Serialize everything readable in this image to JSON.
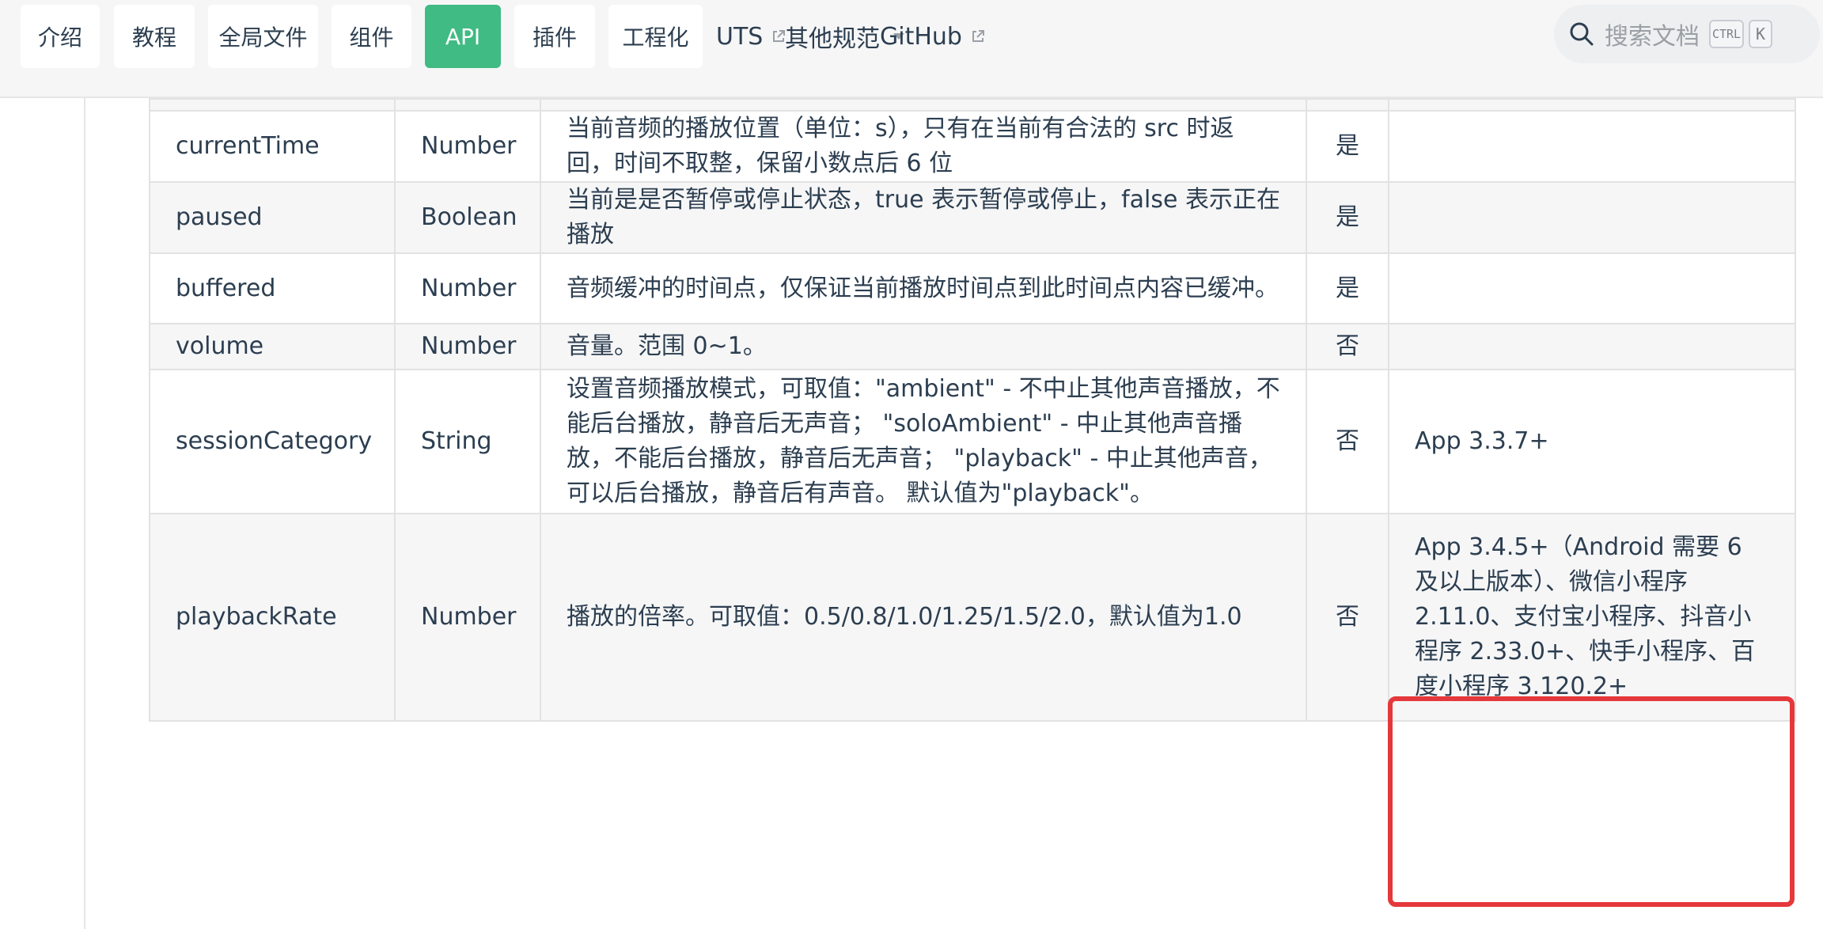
{
  "nav": {
    "tabs": [
      {
        "label": "介绍"
      },
      {
        "label": "教程"
      },
      {
        "label": "全局文件"
      },
      {
        "label": "组件"
      },
      {
        "label": "API"
      },
      {
        "label": "插件"
      },
      {
        "label": "工程化"
      }
    ],
    "active_tab": "API",
    "links": {
      "uts": "UTS",
      "other": "其他规范",
      "github": "GitHub"
    },
    "search": {
      "placeholder": "搜索文档",
      "kbd_ctrl": "CTRL",
      "kbd_k": "K"
    }
  },
  "table": {
    "rows": [
      {
        "name": "",
        "type": "",
        "desc": "",
        "required": "",
        "platform": ""
      },
      {
        "name": "currentTime",
        "type": "Number",
        "desc": "当前音频的播放位置（单位：s），只有在当前有合法的 src 时返回，时间不取整，保留小数点后 6 位",
        "required": "是",
        "platform": ""
      },
      {
        "name": "paused",
        "type": "Boolean",
        "desc": "当前是是否暂停或停止状态，true 表示暂停或停止，false 表示正在播放",
        "required": "是",
        "platform": ""
      },
      {
        "name": "buffered",
        "type": "Number",
        "desc": "音频缓冲的时间点，仅保证当前播放时间点到此时间点内容已缓冲。",
        "required": "是",
        "platform": ""
      },
      {
        "name": "volume",
        "type": "Number",
        "desc": "音量。范围 0~1。",
        "required": "否",
        "platform": ""
      },
      {
        "name": "sessionCategory",
        "type": "String",
        "desc": "设置音频播放模式，可取值：\"ambient\" - 不中止其他声音播放，不能后台播放，静音后无声音； \"soloAmbient\" - 中止其他声音播放，不能后台播放，静音后无声音； \"playback\" - 中止其他声音，可以后台播放，静音后有声音。 默认值为\"playback\"。",
        "required": "否",
        "platform": "App 3.3.7+"
      },
      {
        "name": "playbackRate",
        "type": "Number",
        "desc": "播放的倍率。可取值：0.5/0.8/1.0/1.25/1.5/2.0，默认值为1.0",
        "required": "否",
        "platform": "App 3.4.5+（Android 需要 6 及以上版本）、微信小程序 2.11.0、支付宝小程序、抖音小程序 2.33.0+、快手小程序、百度小程序 3.120.2+"
      }
    ]
  }
}
